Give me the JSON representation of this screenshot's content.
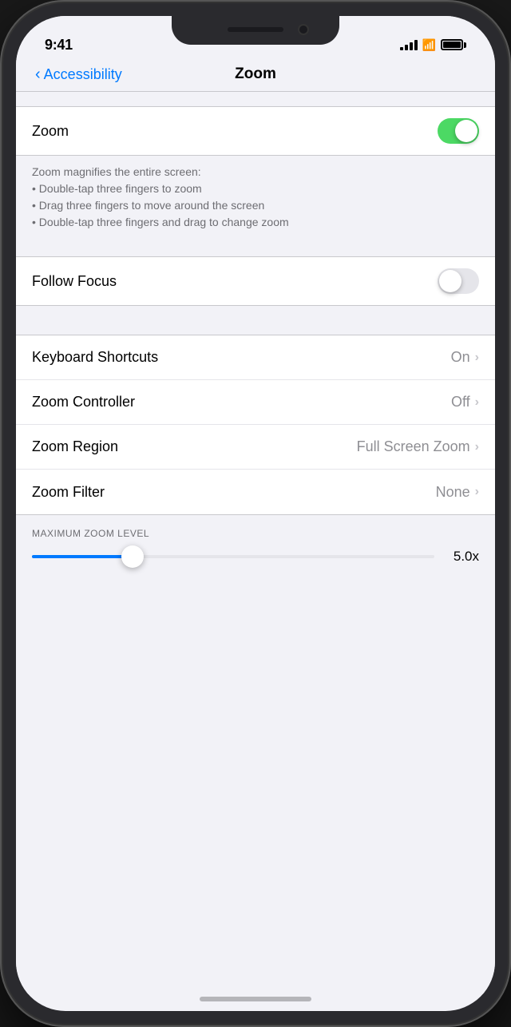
{
  "status": {
    "time": "9:41",
    "battery_full": true
  },
  "nav": {
    "back_label": "Accessibility",
    "title": "Zoom"
  },
  "zoom_toggle": {
    "label": "Zoom",
    "state": "on"
  },
  "description": {
    "intro": "Zoom magnifies the entire screen:",
    "bullets": [
      "Double-tap three fingers to zoom",
      "Drag three fingers to move around the screen",
      "Double-tap three fingers and drag to change zoom"
    ]
  },
  "follow_focus": {
    "label": "Follow Focus",
    "state": "off"
  },
  "menu_items": [
    {
      "label": "Keyboard Shortcuts",
      "value": "On"
    },
    {
      "label": "Zoom Controller",
      "value": "Off"
    },
    {
      "label": "Zoom Region",
      "value": "Full Screen Zoom"
    },
    {
      "label": "Zoom Filter",
      "value": "None"
    }
  ],
  "slider": {
    "section_label": "MAXIMUM ZOOM LEVEL",
    "value": "5.0x",
    "percent": 25
  }
}
